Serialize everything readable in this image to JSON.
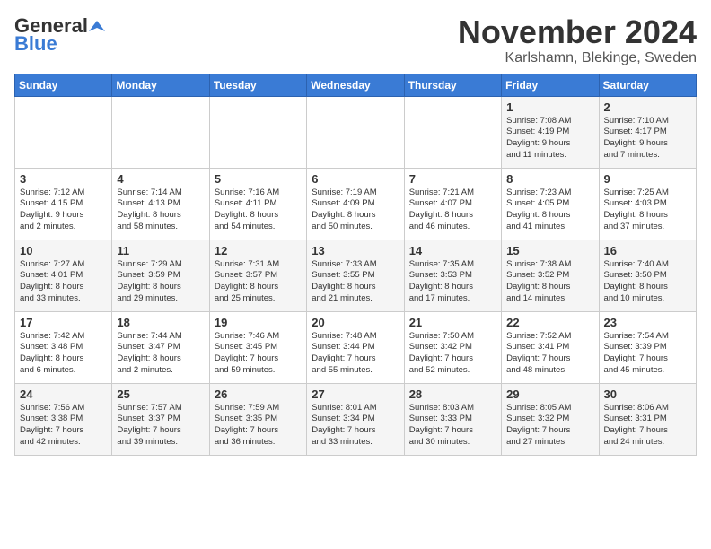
{
  "header": {
    "logo_general": "General",
    "logo_blue": "Blue",
    "month_title": "November 2024",
    "location": "Karlshamn, Blekinge, Sweden"
  },
  "days_of_week": [
    "Sunday",
    "Monday",
    "Tuesday",
    "Wednesday",
    "Thursday",
    "Friday",
    "Saturday"
  ],
  "weeks": [
    [
      {
        "day": "",
        "lines": []
      },
      {
        "day": "",
        "lines": []
      },
      {
        "day": "",
        "lines": []
      },
      {
        "day": "",
        "lines": []
      },
      {
        "day": "",
        "lines": []
      },
      {
        "day": "1",
        "lines": [
          "Sunrise: 7:08 AM",
          "Sunset: 4:19 PM",
          "Daylight: 9 hours",
          "and 11 minutes."
        ]
      },
      {
        "day": "2",
        "lines": [
          "Sunrise: 7:10 AM",
          "Sunset: 4:17 PM",
          "Daylight: 9 hours",
          "and 7 minutes."
        ]
      }
    ],
    [
      {
        "day": "3",
        "lines": [
          "Sunrise: 7:12 AM",
          "Sunset: 4:15 PM",
          "Daylight: 9 hours",
          "and 2 minutes."
        ]
      },
      {
        "day": "4",
        "lines": [
          "Sunrise: 7:14 AM",
          "Sunset: 4:13 PM",
          "Daylight: 8 hours",
          "and 58 minutes."
        ]
      },
      {
        "day": "5",
        "lines": [
          "Sunrise: 7:16 AM",
          "Sunset: 4:11 PM",
          "Daylight: 8 hours",
          "and 54 minutes."
        ]
      },
      {
        "day": "6",
        "lines": [
          "Sunrise: 7:19 AM",
          "Sunset: 4:09 PM",
          "Daylight: 8 hours",
          "and 50 minutes."
        ]
      },
      {
        "day": "7",
        "lines": [
          "Sunrise: 7:21 AM",
          "Sunset: 4:07 PM",
          "Daylight: 8 hours",
          "and 46 minutes."
        ]
      },
      {
        "day": "8",
        "lines": [
          "Sunrise: 7:23 AM",
          "Sunset: 4:05 PM",
          "Daylight: 8 hours",
          "and 41 minutes."
        ]
      },
      {
        "day": "9",
        "lines": [
          "Sunrise: 7:25 AM",
          "Sunset: 4:03 PM",
          "Daylight: 8 hours",
          "and 37 minutes."
        ]
      }
    ],
    [
      {
        "day": "10",
        "lines": [
          "Sunrise: 7:27 AM",
          "Sunset: 4:01 PM",
          "Daylight: 8 hours",
          "and 33 minutes."
        ]
      },
      {
        "day": "11",
        "lines": [
          "Sunrise: 7:29 AM",
          "Sunset: 3:59 PM",
          "Daylight: 8 hours",
          "and 29 minutes."
        ]
      },
      {
        "day": "12",
        "lines": [
          "Sunrise: 7:31 AM",
          "Sunset: 3:57 PM",
          "Daylight: 8 hours",
          "and 25 minutes."
        ]
      },
      {
        "day": "13",
        "lines": [
          "Sunrise: 7:33 AM",
          "Sunset: 3:55 PM",
          "Daylight: 8 hours",
          "and 21 minutes."
        ]
      },
      {
        "day": "14",
        "lines": [
          "Sunrise: 7:35 AM",
          "Sunset: 3:53 PM",
          "Daylight: 8 hours",
          "and 17 minutes."
        ]
      },
      {
        "day": "15",
        "lines": [
          "Sunrise: 7:38 AM",
          "Sunset: 3:52 PM",
          "Daylight: 8 hours",
          "and 14 minutes."
        ]
      },
      {
        "day": "16",
        "lines": [
          "Sunrise: 7:40 AM",
          "Sunset: 3:50 PM",
          "Daylight: 8 hours",
          "and 10 minutes."
        ]
      }
    ],
    [
      {
        "day": "17",
        "lines": [
          "Sunrise: 7:42 AM",
          "Sunset: 3:48 PM",
          "Daylight: 8 hours",
          "and 6 minutes."
        ]
      },
      {
        "day": "18",
        "lines": [
          "Sunrise: 7:44 AM",
          "Sunset: 3:47 PM",
          "Daylight: 8 hours",
          "and 2 minutes."
        ]
      },
      {
        "day": "19",
        "lines": [
          "Sunrise: 7:46 AM",
          "Sunset: 3:45 PM",
          "Daylight: 7 hours",
          "and 59 minutes."
        ]
      },
      {
        "day": "20",
        "lines": [
          "Sunrise: 7:48 AM",
          "Sunset: 3:44 PM",
          "Daylight: 7 hours",
          "and 55 minutes."
        ]
      },
      {
        "day": "21",
        "lines": [
          "Sunrise: 7:50 AM",
          "Sunset: 3:42 PM",
          "Daylight: 7 hours",
          "and 52 minutes."
        ]
      },
      {
        "day": "22",
        "lines": [
          "Sunrise: 7:52 AM",
          "Sunset: 3:41 PM",
          "Daylight: 7 hours",
          "and 48 minutes."
        ]
      },
      {
        "day": "23",
        "lines": [
          "Sunrise: 7:54 AM",
          "Sunset: 3:39 PM",
          "Daylight: 7 hours",
          "and 45 minutes."
        ]
      }
    ],
    [
      {
        "day": "24",
        "lines": [
          "Sunrise: 7:56 AM",
          "Sunset: 3:38 PM",
          "Daylight: 7 hours",
          "and 42 minutes."
        ]
      },
      {
        "day": "25",
        "lines": [
          "Sunrise: 7:57 AM",
          "Sunset: 3:37 PM",
          "Daylight: 7 hours",
          "and 39 minutes."
        ]
      },
      {
        "day": "26",
        "lines": [
          "Sunrise: 7:59 AM",
          "Sunset: 3:35 PM",
          "Daylight: 7 hours",
          "and 36 minutes."
        ]
      },
      {
        "day": "27",
        "lines": [
          "Sunrise: 8:01 AM",
          "Sunset: 3:34 PM",
          "Daylight: 7 hours",
          "and 33 minutes."
        ]
      },
      {
        "day": "28",
        "lines": [
          "Sunrise: 8:03 AM",
          "Sunset: 3:33 PM",
          "Daylight: 7 hours",
          "and 30 minutes."
        ]
      },
      {
        "day": "29",
        "lines": [
          "Sunrise: 8:05 AM",
          "Sunset: 3:32 PM",
          "Daylight: 7 hours",
          "and 27 minutes."
        ]
      },
      {
        "day": "30",
        "lines": [
          "Sunrise: 8:06 AM",
          "Sunset: 3:31 PM",
          "Daylight: 7 hours",
          "and 24 minutes."
        ]
      }
    ]
  ]
}
